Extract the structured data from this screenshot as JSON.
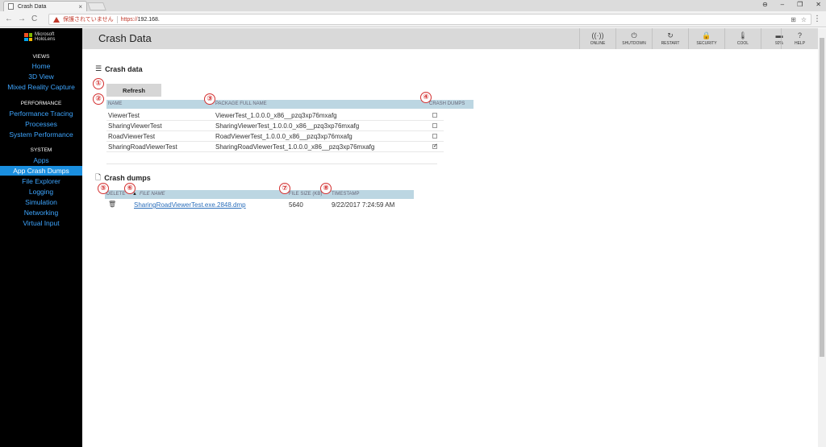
{
  "browser": {
    "tab_title": "Crash Data",
    "tab_close": "×",
    "window_controls": [
      "⊖",
      "–",
      "❐",
      "✕"
    ],
    "insecure_label": "保護されていません",
    "url_scheme": "https://",
    "url_host": "192.168.",
    "nav": [
      "←",
      "→",
      "C"
    ],
    "toolbar_icons": [
      "⊞",
      "☆"
    ],
    "menu": "⋮"
  },
  "sidebar": {
    "logo_line1": "Microsoft",
    "logo_line2": "HoloLens",
    "logo_colors": [
      "#f25022",
      "#7fba00",
      "#00a4ef",
      "#ffb900"
    ],
    "sections": [
      {
        "heading": "VIEWS",
        "items": [
          "Home",
          "3D View",
          "Mixed Reality Capture"
        ]
      },
      {
        "heading": "PERFORMANCE",
        "items": [
          "Performance Tracing",
          "Processes",
          "System Performance"
        ]
      },
      {
        "heading": "SYSTEM",
        "items": [
          "Apps",
          "App Crash Dumps",
          "File Explorer",
          "Logging",
          "Simulation",
          "Networking",
          "Virtual Input"
        ]
      }
    ],
    "active_item": "App Crash Dumps"
  },
  "header": {
    "title": "Crash Data",
    "buttons": [
      {
        "icon": "((·))",
        "label": "ONLINE"
      },
      {
        "icon": "⏻",
        "label": "SHUTDOWN"
      },
      {
        "icon": "↻",
        "label": "RESTART"
      },
      {
        "icon": "🔒",
        "label": "SECURITY"
      },
      {
        "icon": "🌡",
        "label": "COOL"
      },
      {
        "icon": "▬",
        "label": "92%"
      },
      {
        "icon": "?",
        "label": "HELP"
      }
    ]
  },
  "crash_data": {
    "title": "Crash data",
    "refresh_label": "Refresh",
    "columns": {
      "name": "NAME",
      "package": "PACKAGE FULL NAME",
      "dumps": "CRASH DUMPS"
    },
    "rows": [
      {
        "name": "ViewerTest",
        "package": "ViewerTest_1.0.0.0_x86__pzq3xp76mxafg",
        "checked": false
      },
      {
        "name": "SharingViewerTest",
        "package": "SharingViewerTest_1.0.0.0_x86__pzq3xp76mxafg",
        "checked": false
      },
      {
        "name": "RoadViewerTest",
        "package": "RoadViewerTest_1.0.0.0_x86__pzq3xp76mxafg",
        "checked": false
      },
      {
        "name": "SharingRoadViewerTest",
        "package": "SharingRoadViewerTest_1.0.0.0_x86__pzq3xp76mxafg",
        "checked": true
      }
    ]
  },
  "crash_dumps": {
    "title": "Crash dumps",
    "columns": {
      "delete": "DELETE",
      "sort_arrow": "▲",
      "file_name": "FILE NAME",
      "size": "FILE SIZE (KB)",
      "timestamp": "TIMESTAMP"
    },
    "rows": [
      {
        "file_name": "SharingRoadViewerTest.exe.2848.dmp",
        "size": "5640",
        "timestamp": "9/22/2017 7:24:59 AM"
      }
    ]
  },
  "markers": [
    "①",
    "②",
    "③",
    "④",
    "⑤",
    "⑥",
    "⑦",
    "⑧"
  ]
}
